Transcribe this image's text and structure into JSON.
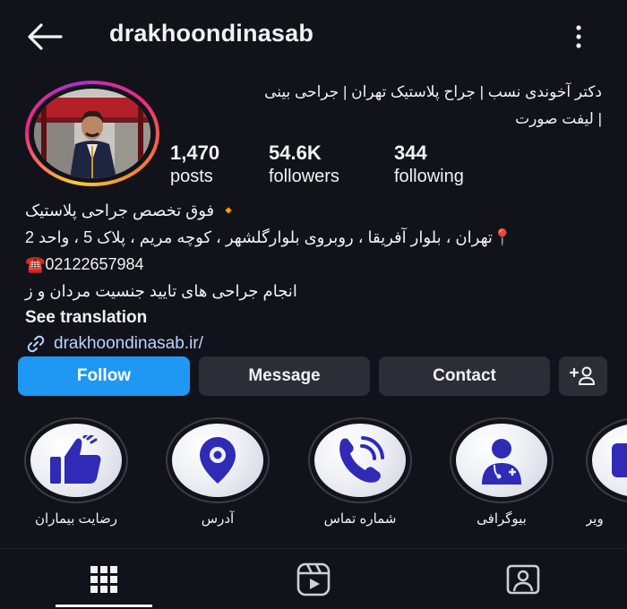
{
  "header": {
    "username": "drakhoondinasab"
  },
  "profile": {
    "bio_top_line1": "دکتر آخوندی نسب | جراح پلاستیک تهران | جراحی بینی",
    "bio_top_line2": "| لیفت صورت",
    "stats": [
      {
        "value": "1,470",
        "label": "posts"
      },
      {
        "value": "54.6K",
        "label": "followers"
      },
      {
        "value": "344",
        "label": "following"
      }
    ],
    "bio_lines": [
      "🔸 فوق تخصص جراحی پلاستیک",
      "📍تهران ، بلوار آفریقا ، روبروی بلوارگلشهر ، کوچه مریم ، پلاک 5 ، واحد 2",
      "☎️02122657984",
      "انجام جراحی های تایید جنسیت مردان و ز"
    ],
    "see_translation": "See translation",
    "link": "drakhoondinasab.ir/"
  },
  "actions": {
    "follow": "Follow",
    "message": "Message",
    "contact": "Contact"
  },
  "highlights": [
    {
      "label": "رضایت بیماران",
      "icon": "thumbs-up-icon"
    },
    {
      "label": "آدرس",
      "icon": "location-pin-icon"
    },
    {
      "label": "شماره تماس",
      "icon": "phone-icon"
    },
    {
      "label": "بیوگرافی",
      "icon": "doctor-icon"
    },
    {
      "label": "ویر",
      "icon": "video-icon"
    }
  ],
  "colors": {
    "background": "#12131a",
    "follow_button": "#1e98f2",
    "secondary_button": "#2b2e36",
    "highlight_icon": "#2f2bb6"
  }
}
